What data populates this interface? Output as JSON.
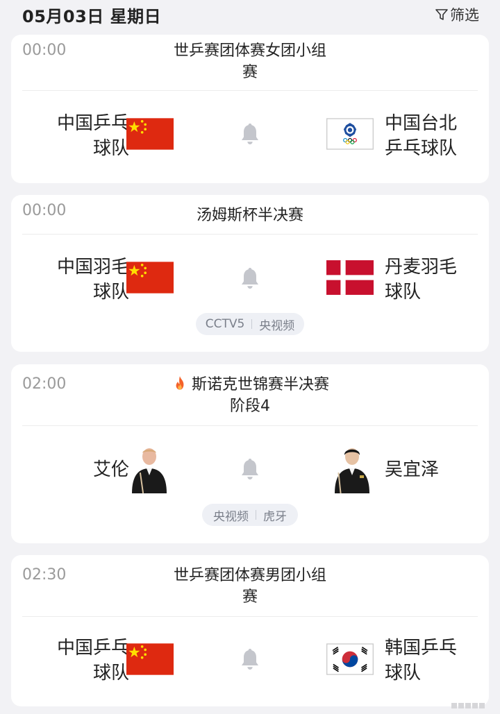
{
  "header": {
    "date": "05月03日 星期日",
    "filter_label": "筛选"
  },
  "matches": [
    {
      "time": "00:00",
      "event_line1": "世乒赛团体赛女团小组",
      "event_line2": "赛",
      "home": {
        "line1": "中国乒乓",
        "line2": "球队",
        "flag": "china-flag"
      },
      "away": {
        "line1": "中国台北",
        "line2": "乒乓球队",
        "flag": "chinese-taipei-olympic-flag"
      }
    },
    {
      "time": "00:00",
      "event_line1": "汤姆斯杯半决赛",
      "home": {
        "line1": "中国羽毛",
        "line2": "球队",
        "flag": "china-flag"
      },
      "away": {
        "line1": "丹麦羽毛",
        "line2": "球队",
        "flag": "denmark-flag"
      },
      "broadcasts": [
        "CCTV5",
        "央视频"
      ]
    },
    {
      "time": "02:00",
      "event_line1": "斯诺克世锦赛半决赛",
      "event_line2": "阶段4",
      "hot_icon": "fire-icon",
      "home": {
        "line1": "艾伦",
        "avatar": "player-avatar"
      },
      "away": {
        "line1": "吴宜泽",
        "avatar": "player-avatar"
      },
      "broadcasts": [
        "央视频",
        "虎牙"
      ]
    },
    {
      "time": "02:30",
      "event_line1": "世乒赛团体赛男团小组",
      "event_line2": "赛",
      "home": {
        "line1": "中国乒乓",
        "line2": "球队",
        "flag": "china-flag"
      },
      "away": {
        "line1": "韩国乒乓",
        "line2": "球队",
        "flag": "korea-flag"
      }
    }
  ],
  "colors": {
    "china_red": "#de2910",
    "star_yellow": "#ffde00",
    "denmark_red": "#c8102e",
    "bell_gray": "#c4c6cc"
  }
}
